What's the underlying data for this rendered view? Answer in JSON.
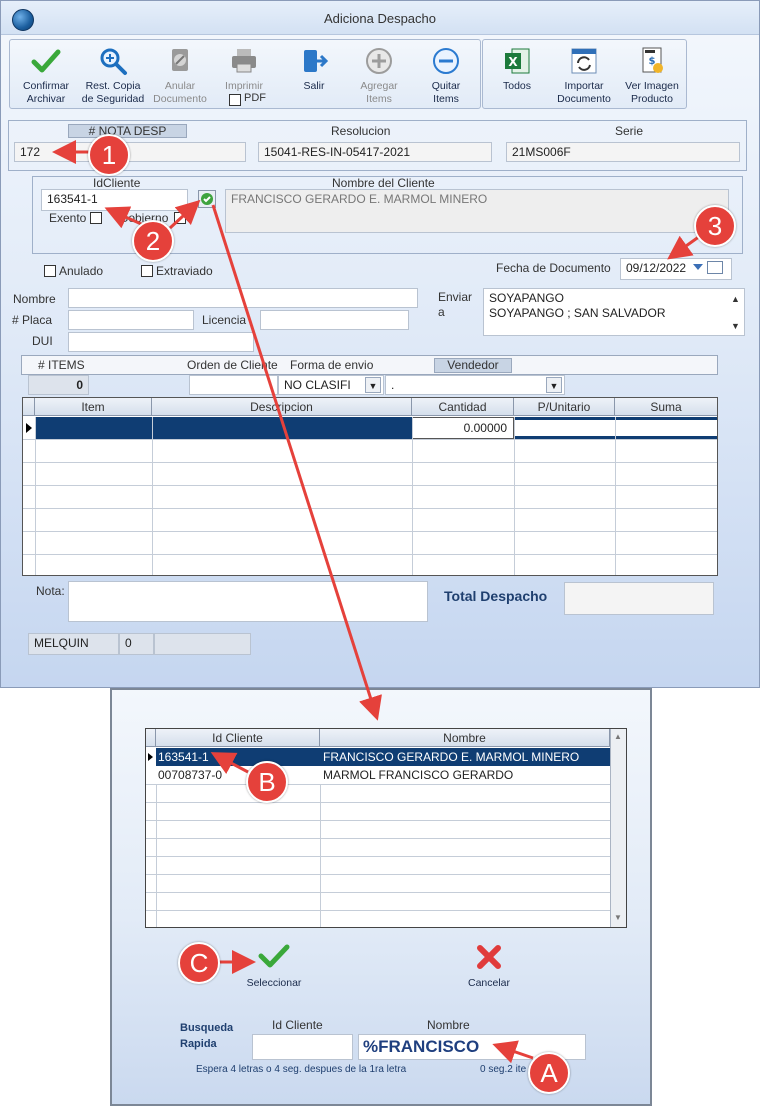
{
  "main": {
    "title": "Adiciona Despacho",
    "toolbar": [
      {
        "label": "Confirmar\nArchivar",
        "icon": "checkmark-icon",
        "enabled": true
      },
      {
        "label": "Rest. Copia\nde Seguridad",
        "icon": "magnify-icon",
        "enabled": true
      },
      {
        "label": "Anular\nDocumento",
        "icon": "void-document-icon",
        "enabled": false
      },
      {
        "label": "Imprimir",
        "icon": "printer-icon",
        "enabled": false
      },
      {
        "label": "Salir",
        "icon": "exit-icon",
        "enabled": true
      },
      {
        "label": "Agregar\nItems",
        "icon": "add-icon",
        "enabled": false
      },
      {
        "label": "Quitar\nItems",
        "icon": "remove-icon",
        "enabled": true
      }
    ],
    "pdf_label": "PDF",
    "toolbar2": [
      {
        "label": "Todos",
        "icon": "excel-icon"
      },
      {
        "label": "Importar\nDocumento",
        "icon": "import-icon"
      },
      {
        "label": "Ver Imagen\nProducto",
        "icon": "invoice-image-icon"
      }
    ],
    "nota_desp_label": "# NOTA DESP",
    "nota_desp_value": "172",
    "resolucion_label": "Resolucion",
    "resolucion_value": "15041-RES-IN-05417-2021",
    "serie_label": "Serie",
    "serie_value": "21MS006F",
    "idcliente_label": "IdCliente",
    "idcliente_value": "163541-1",
    "nombre_cliente_label": "Nombre del Cliente",
    "nombre_cliente_value": "FRANCISCO GERARDO E. MARMOL MINERO",
    "exento_label": "Exento",
    "gobierno_label": "Gobierno",
    "anulado_label": "Anulado",
    "extraviado_label": "Extraviado",
    "fecha_label": "Fecha de Documento",
    "fecha_value": "09/12/2022",
    "nombre_label": "Nombre",
    "placa_label": "# Placa",
    "licencia_label": "Licencia",
    "dui_label": "DUI",
    "enviar_label": "Enviar\na",
    "enviar_line1": "SOYAPANGO",
    "enviar_line2": "SOYAPANGO ; SAN SALVADOR",
    "items_label": "# ITEMS",
    "items_value": "0",
    "orden_label": "Orden de Cliente",
    "forma_label": "Forma de envio",
    "vendedor_label": "Vendedor",
    "forma_value": "NO CLASIFI",
    "vendedor_value": ".",
    "grid_cols": [
      "Item",
      "Descripcion",
      "Cantidad",
      "P/Unitario",
      "Suma"
    ],
    "grid_first_qty": "0.00000",
    "nota_label": "Nota:",
    "total_label": "Total Despacho",
    "footer_user": "MELQUIN",
    "footer_num": "0"
  },
  "popup": {
    "cols": [
      "Id Cliente",
      "Nombre"
    ],
    "rows": [
      {
        "id": "163541-1",
        "name": "FRANCISCO GERARDO E. MARMOL MINERO"
      },
      {
        "id": "00708737-0",
        "name": "MARMOL FRANCISCO GERARDO"
      }
    ],
    "select_label": "Seleccionar",
    "cancel_label": "Cancelar",
    "busqueda_label": "Busqueda\nRapida",
    "idcliente_label": "Id Cliente",
    "nombre_label": "Nombre",
    "search_value": "%FRANCISCO",
    "hint_left": "Espera 4 letras o 4 seg. despues de la 1ra letra",
    "hint_right": "0 seg.2 ite"
  },
  "callouts": [
    "1",
    "2",
    "3",
    "B",
    "C",
    "A"
  ],
  "colors": {
    "callout": "#e5413b",
    "selection": "#0f3d73",
    "accent": "#1f4f8f"
  }
}
